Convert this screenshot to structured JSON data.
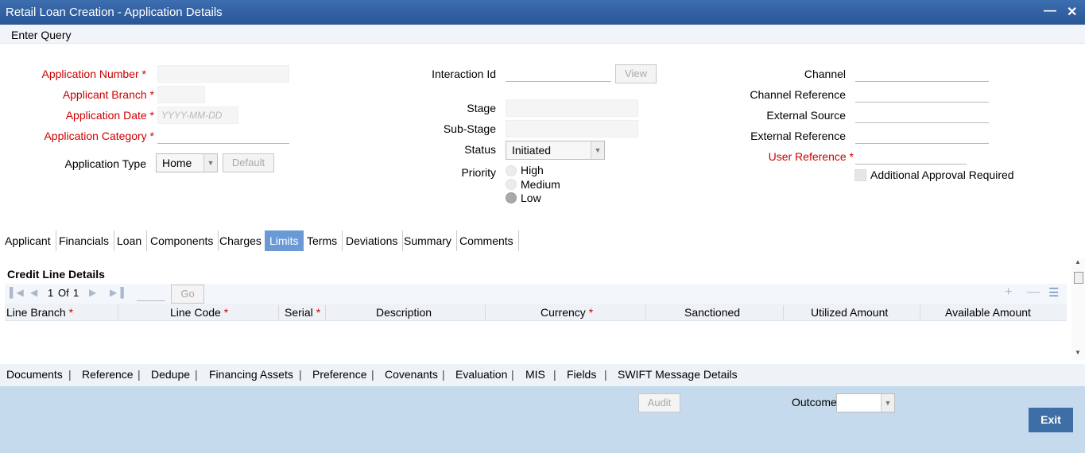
{
  "window": {
    "title": "Retail Loan Creation - Application Details",
    "minimize": "—",
    "close": "✕"
  },
  "menu": {
    "enter_query": "Enter Query"
  },
  "left": {
    "application_number": "Application Number",
    "applicant_branch": "Applicant Branch",
    "application_date": "Application Date",
    "application_date_placeholder": "YYYY-MM-DD",
    "application_category": "Application Category",
    "application_type": "Application Type",
    "application_type_value": "Home",
    "default_button": "Default",
    "required_mark": "*"
  },
  "middle": {
    "interaction_id": "Interaction Id",
    "view_button": "View",
    "stage": "Stage",
    "sub_stage": "Sub-Stage",
    "status": "Status",
    "status_value": "Initiated",
    "priority": "Priority",
    "priority_options": [
      "High",
      "Medium",
      "Low"
    ],
    "priority_selected": "Low"
  },
  "right": {
    "channel": "Channel",
    "channel_reference": "Channel Reference",
    "external_source": "External Source",
    "external_reference": "External Reference",
    "user_reference": "User Reference",
    "additional_approval": "Additional Approval Required"
  },
  "tabs": [
    "Applicant",
    "Financials",
    "Loan",
    "Components",
    "Charges",
    "Limits",
    "Terms",
    "Deviations",
    "Summary",
    "Comments"
  ],
  "active_tab": "Limits",
  "credit_line": {
    "title": "Credit Line Details",
    "page": "1",
    "of_label": "Of",
    "total_pages": "1",
    "go_button": "Go",
    "columns": [
      "Line Branch",
      "Line Code",
      "Serial",
      "Description",
      "Currency",
      "Sanctioned",
      "Utilized Amount",
      "Available Amount"
    ],
    "required_columns": [
      "Line Branch",
      "Line Code",
      "Serial",
      "Currency"
    ]
  },
  "bottom_links": [
    "Documents",
    "Reference",
    "Dedupe",
    "Financing Assets",
    "Preference",
    "Covenants",
    "Evaluation",
    "MIS",
    "Fields",
    "SWIFT Message Details"
  ],
  "footer": {
    "audit_button": "Audit",
    "outcome_label": "Outcome",
    "exit_button": "Exit"
  },
  "colors": {
    "title_bar": "#2f5e9f",
    "required_label": "#cc0000",
    "active_tab": "#6a9ad6",
    "footer": "#c5daec",
    "exit_button": "#3d6ea6"
  }
}
